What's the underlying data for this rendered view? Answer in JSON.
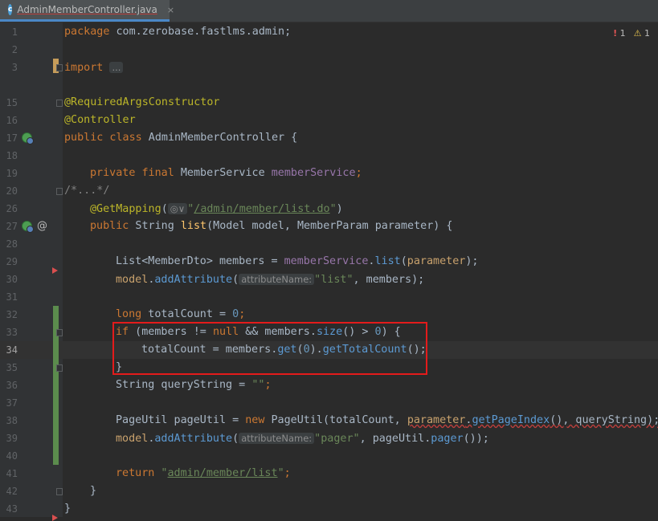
{
  "tab": {
    "filename": "AdminMemberController.java",
    "file_icon_letter": "c",
    "close": "×"
  },
  "status": {
    "errors": "1",
    "warnings": "1"
  },
  "code": {
    "l1_kw": "package",
    "l1_rest": " com.zerobase.fastlms.admin;",
    "l3_kw": "import",
    "l3_fold": "...",
    "l15": "@RequiredArgsConstructor",
    "l16": "@Controller",
    "l17_kw": "public class",
    "l17_rest": " AdminMemberController {",
    "l19_kw": "private final",
    "l19_type": " MemberService ",
    "l19_fld": "memberService",
    "l19_end": ";",
    "l20": "/*...*/",
    "l26_ann": "@GetMapping",
    "l26_open": "(",
    "l26_icon": "◎∨",
    "l26_q": "\"",
    "l26_str": "/admin/member/list.do",
    "l26_q2": "\"",
    "l26_close": ")",
    "l27_kw": "public",
    "l27_type": " String ",
    "l27_mth": "list",
    "l27_rest": "(Model model, MemberParam parameter) {",
    "l29_a": "List<MemberDto> members = ",
    "l29_fld": "memberService",
    "l29_dot": ".",
    "l29_call": "list",
    "l29_open": "(",
    "l29_param": "parameter",
    "l29_end": ");",
    "l30_obj": "model",
    "l30_dot": ".",
    "l30_call": "addAttribute",
    "l30_open": "(",
    "l30_hint": "attributeName:",
    "l30_str": "\"list\"",
    "l30_end": ", members);",
    "l32_kw": "long",
    "l32_mid": " totalCount = ",
    "l32_num": "0",
    "l32_end": ";",
    "l33_kw": "if",
    "l33_a": " (members != ",
    "l33_null": "null",
    "l33_b": " && members.",
    "l33_call": "size",
    "l33_c": "() > ",
    "l33_num": "0",
    "l33_d": ") {",
    "l34_a": "totalCount = members.",
    "l34_call": "get",
    "l34_open": "(",
    "l34_num": "0",
    "l34_b": ").",
    "l34_call2": "getTotalCount",
    "l34_end": "();",
    "l35": "}",
    "l36_a": "String queryString = ",
    "l36_str": "\"\"",
    "l36_end": ";",
    "l38_a": "PageUtil pageUtil = ",
    "l38_new": "new",
    "l38_b": " PageUtil(totalCount, ",
    "l38_param": "parameter",
    "l38_dot": ".",
    "l38_call": "getPageIndex",
    "l38_end": "(), queryString);",
    "l39_obj": "model",
    "l39_dot": ".",
    "l39_call": "addAttribute",
    "l39_open": "(",
    "l39_hint": "attributeName:",
    "l39_str": "\"pager\"",
    "l39_mid": ", pageUtil.",
    "l39_call2": "pager",
    "l39_end": "());",
    "l41_kw": "return",
    "l41_q": " \"",
    "l41_str": "admin/member/list",
    "l41_q2": "\"",
    "l41_end": ";",
    "l42": "}",
    "l43": "}"
  },
  "line_numbers": [
    "1",
    "2",
    "3",
    "15",
    "16",
    "17",
    "18",
    "19",
    "20",
    "26",
    "27",
    "28",
    "29",
    "30",
    "31",
    "32",
    "33",
    "34",
    "35",
    "36",
    "37",
    "38",
    "39",
    "40",
    "41",
    "42",
    "43"
  ]
}
